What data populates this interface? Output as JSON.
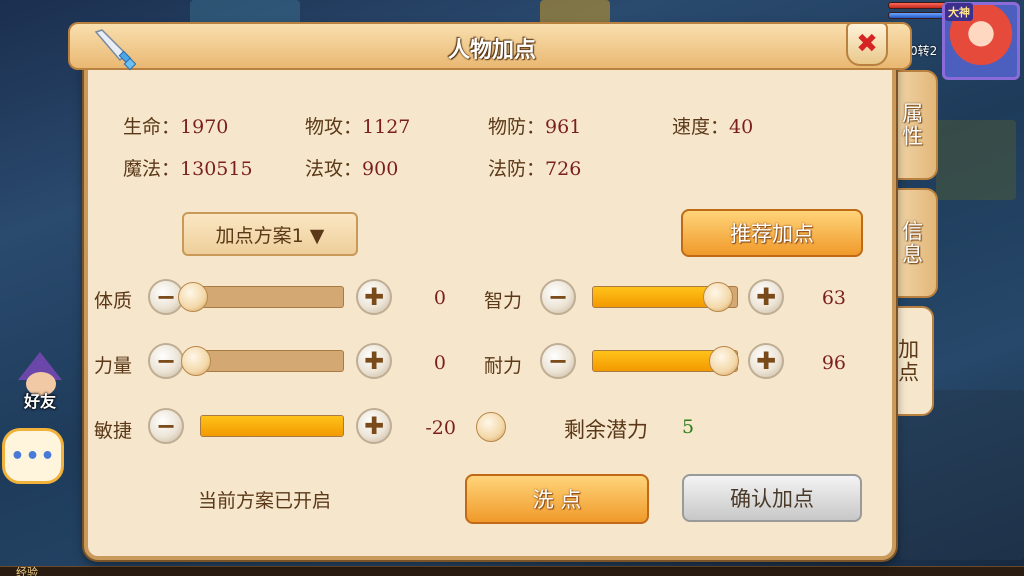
{
  "window": {
    "title": "人物加点"
  },
  "hero": {
    "title": "大神",
    "level_text": "0转2"
  },
  "side": {
    "friends_label": "好友",
    "exp_label": "经验"
  },
  "stats": [
    {
      "label": "生命：",
      "value": "1970"
    },
    {
      "label": "物攻：",
      "value": "1127"
    },
    {
      "label": "物防：",
      "value": "961"
    },
    {
      "label": "速度：",
      "value": "40"
    },
    {
      "label": "魔法：",
      "value": "130515"
    },
    {
      "label": "法攻：",
      "value": "900"
    },
    {
      "label": "法防：",
      "value": "726"
    }
  ],
  "plan": {
    "selected": "加点方案1 ▼"
  },
  "buttons": {
    "recommend": "推荐加点",
    "minus": "−",
    "plus": "✚",
    "reset": "洗  点",
    "confirm": "确认加点",
    "close": "✖"
  },
  "attributes": [
    {
      "label": "体质",
      "value": "0",
      "fill_percent": 0
    },
    {
      "label": "力量",
      "value": "0",
      "fill_percent": 0
    },
    {
      "label": "敏捷",
      "value": "-20",
      "fill_percent": 100
    },
    {
      "label": "智力",
      "value": "63",
      "fill_percent": 85
    },
    {
      "label": "耐力",
      "value": "96",
      "fill_percent": 90
    }
  ],
  "remaining": {
    "label": "剩余潜力",
    "value": "5"
  },
  "status_text": "当前方案已开启",
  "tabs": [
    {
      "label": "属性"
    },
    {
      "label": "信息"
    },
    {
      "label": "加点"
    }
  ],
  "colors": {
    "accent": "#f09a2a",
    "panel": "#f6e6cb",
    "value_text": "#7a1e1e",
    "remaining": "#2e7d1a"
  }
}
